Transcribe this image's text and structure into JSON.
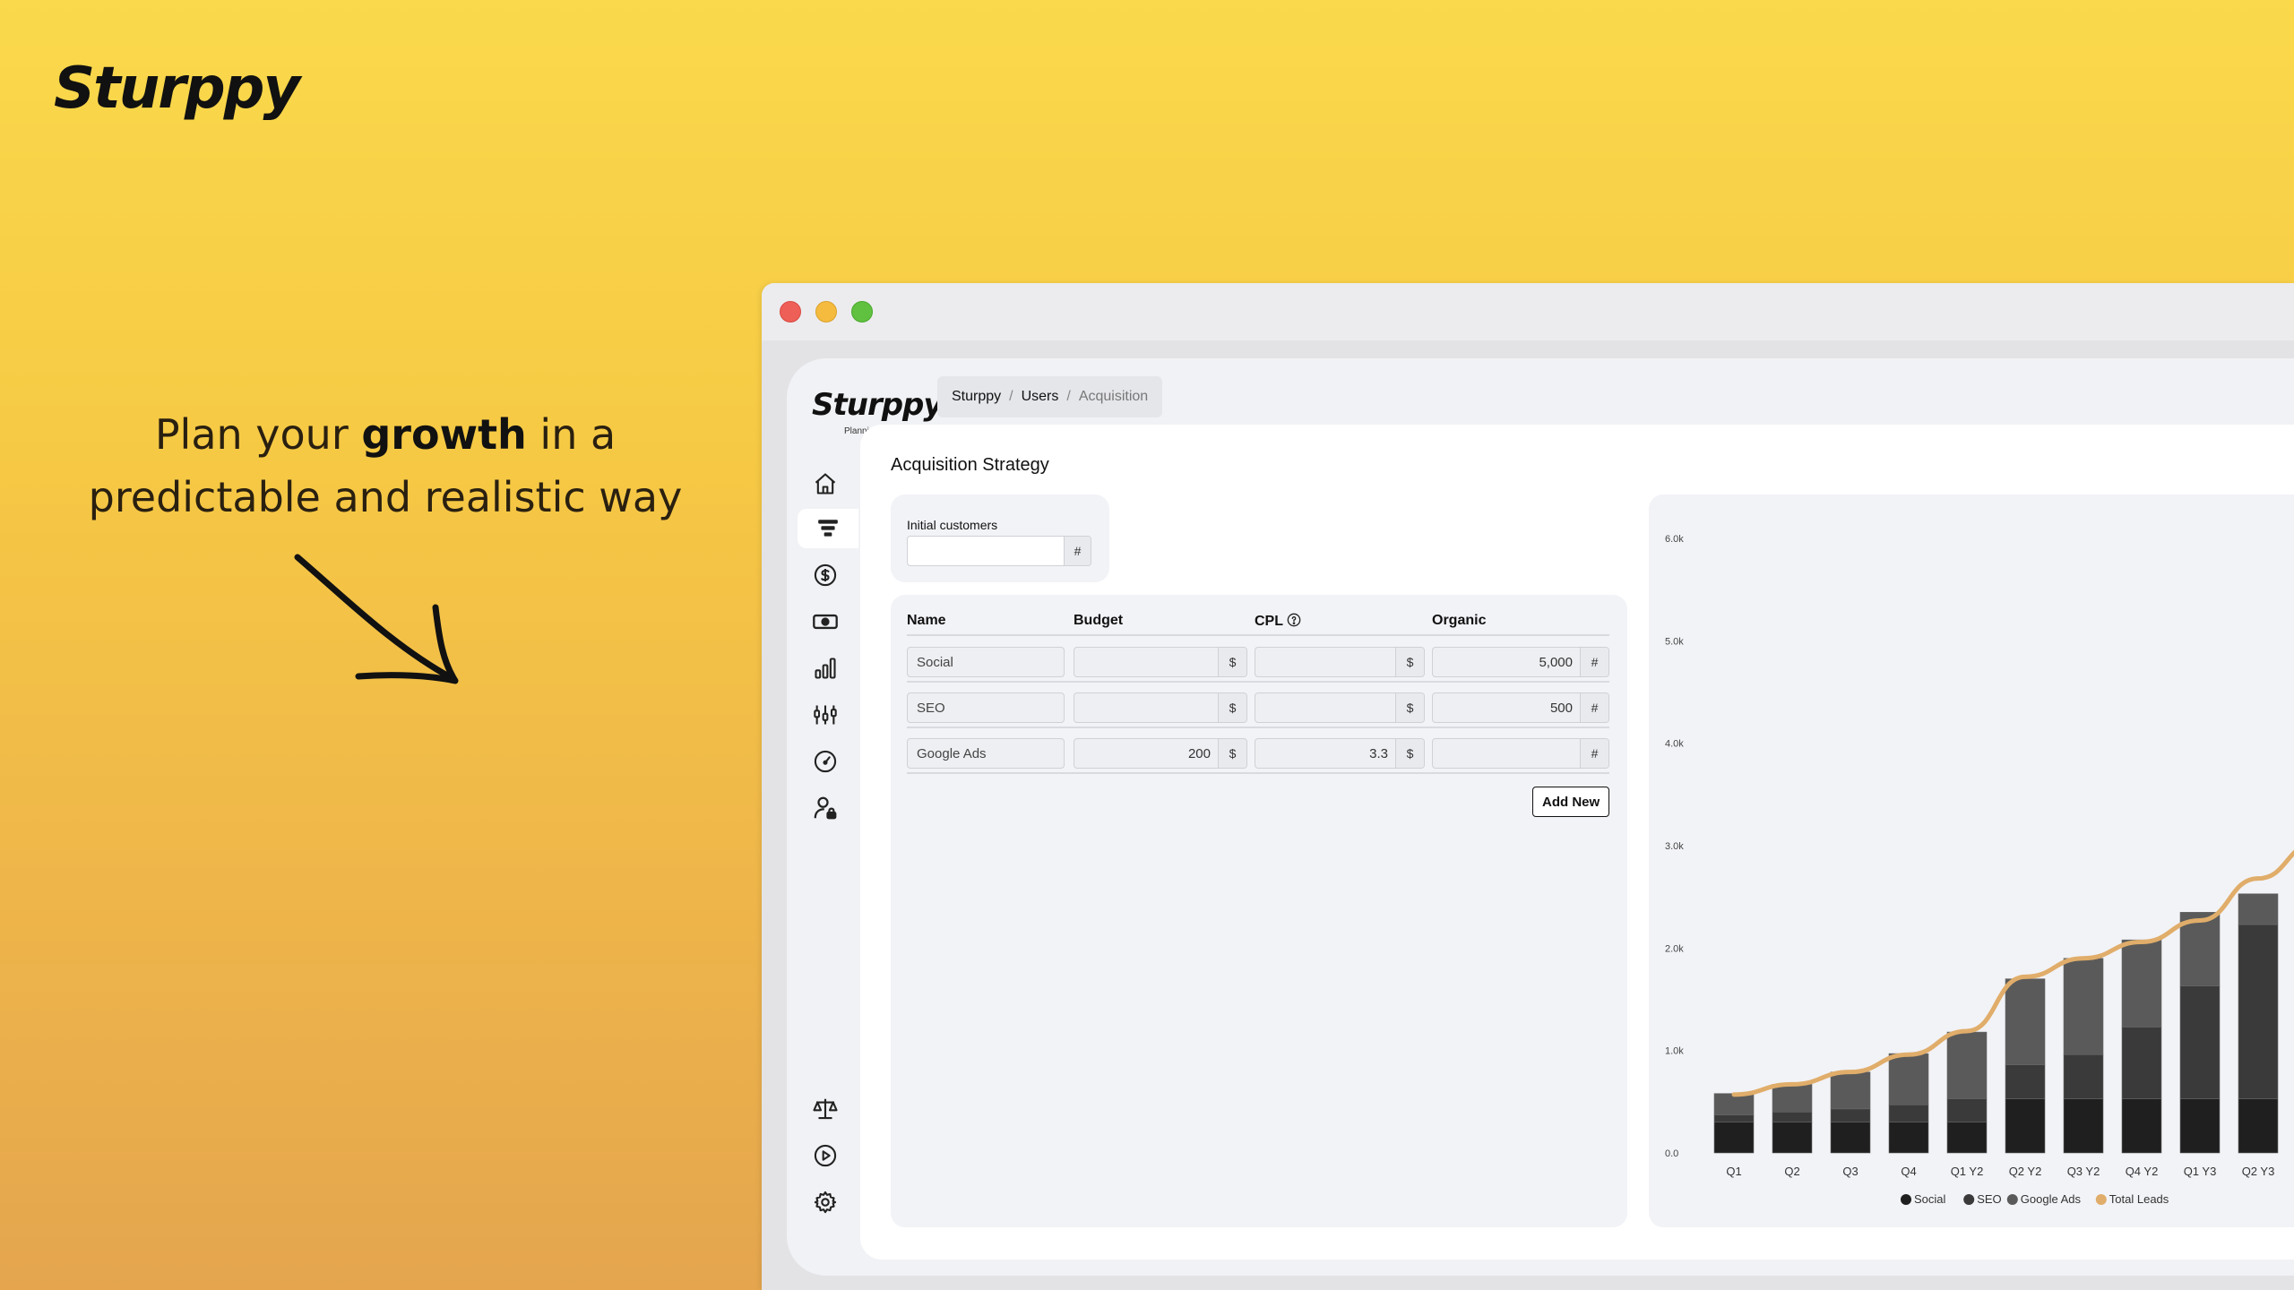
{
  "hero": {
    "logo": "Sturppy",
    "tagline_pre": "Plan your ",
    "tagline_bold": "growth",
    "tagline_post": " in a",
    "tagline_line2": "predictable and realistic way"
  },
  "app": {
    "logo": "Sturppy",
    "logo_sub": "Planning",
    "breadcrumb": [
      "Sturppy",
      "Users",
      "Acquisition"
    ],
    "sidebar": {
      "top_icons": [
        "home-icon",
        "funnel-icon",
        "dollar-circle-icon",
        "banknote-icon",
        "bar-chart-icon",
        "sliders-icon",
        "gauge-icon",
        "user-lock-icon"
      ],
      "bottom_icons": [
        "scale-icon",
        "play-circle-icon",
        "gear-icon"
      ],
      "active": "funnel-icon"
    },
    "page_title": "Acquisition Strategy",
    "initial_customers": {
      "label": "Initial customers",
      "value": "",
      "unit": "#"
    },
    "table": {
      "columns": [
        "Name",
        "Budget",
        "CPL",
        "Organic"
      ],
      "rows": [
        {
          "name": "Social",
          "budget": "",
          "budget_unit": "$",
          "cpl": "",
          "cpl_unit": "$",
          "organic": "5,000",
          "organic_unit": "#"
        },
        {
          "name": "SEO",
          "budget": "",
          "budget_unit": "$",
          "cpl": "",
          "cpl_unit": "$",
          "organic": "500",
          "organic_unit": "#"
        },
        {
          "name": "Google Ads",
          "budget": "200",
          "budget_unit": "$",
          "cpl": "3.3",
          "cpl_unit": "$",
          "organic": "",
          "organic_unit": "#"
        }
      ],
      "add_button": "Add New"
    }
  },
  "colors": {
    "social": "#1f1f1f",
    "seo": "#3a3a3a",
    "google_ads": "#5a5a5a",
    "total_leads": "#e0ad6a"
  },
  "chart_data": {
    "type": "bar",
    "stacked": true,
    "categories": [
      "Q1",
      "Q2",
      "Q3",
      "Q4",
      "Q1 Y2",
      "Q2 Y2",
      "Q3 Y2",
      "Q4 Y2",
      "Q1 Y3",
      "Q2 Y3"
    ],
    "series": [
      {
        "name": "Social",
        "values": [
          300,
          300,
          300,
          300,
          300,
          530,
          530,
          530,
          530,
          530
        ]
      },
      {
        "name": "SEO",
        "values": [
          70,
          100,
          130,
          170,
          230,
          330,
          430,
          700,
          1100,
          1700
        ]
      },
      {
        "name": "Google Ads",
        "values": [
          210,
          270,
          360,
          500,
          650,
          840,
          940,
          850,
          720,
          300
        ]
      }
    ],
    "line": {
      "name": "Total Leads",
      "values": [
        570,
        670,
        790,
        960,
        1190,
        1720,
        1900,
        2060,
        2270,
        2680
      ]
    },
    "yticks": [
      "0.0",
      "1.0k",
      "2.0k",
      "3.0k",
      "4.0k",
      "5.0k",
      "6.0k"
    ],
    "ylim": [
      0,
      6000
    ],
    "legend": [
      "Social",
      "SEO",
      "Google Ads",
      "Total Leads"
    ],
    "legend_position": "bottom"
  }
}
